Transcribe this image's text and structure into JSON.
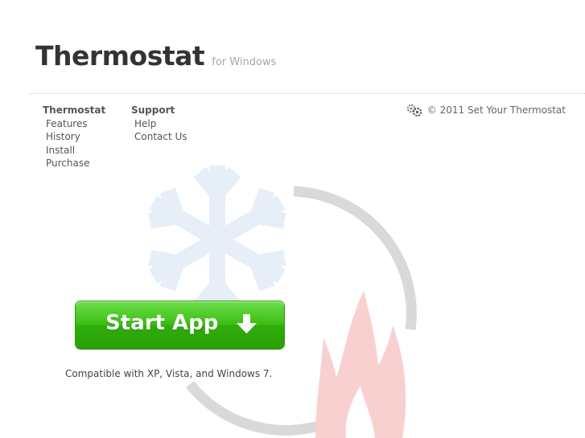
{
  "brand": {
    "title": "Thermostat",
    "subtitle": "for Windows"
  },
  "nav": {
    "thermostat": {
      "heading": "Thermostat",
      "links": [
        "Features",
        "History",
        "Install",
        "Purchase"
      ]
    },
    "support": {
      "heading": "Support",
      "links": [
        "Help",
        "Contact Us"
      ]
    }
  },
  "footer": {
    "copyright": "© 2011 Set Your Thermostat",
    "icon": "gears-icon"
  },
  "cta": {
    "label": "Start App",
    "icon": "down-arrow-icon",
    "color": "#3dbd14"
  },
  "compat_note": "Compatible with XP, Vista, and Windows 7.",
  "art": {
    "snowflake_color": "#e6eef8",
    "ring_color": "#d9d9d9",
    "flame_color": "#f9d0d0",
    "icons": [
      "snowflake-icon",
      "thermostat-ring-icon",
      "flame-icon"
    ]
  }
}
